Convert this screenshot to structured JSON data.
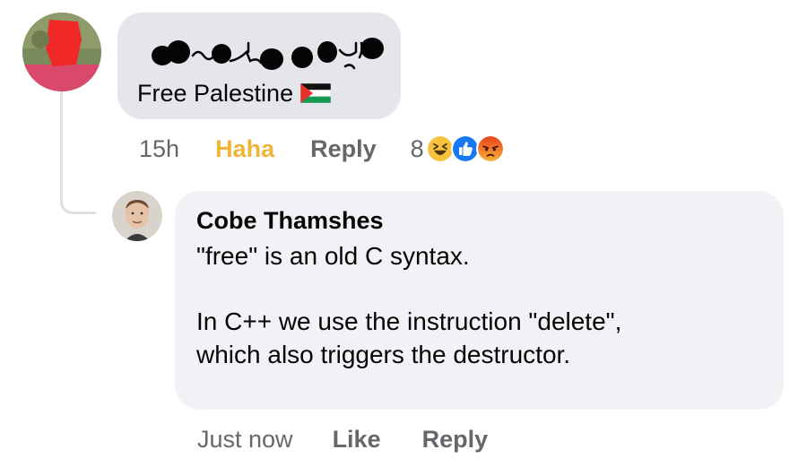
{
  "comment_1": {
    "text": "Free Palestine",
    "emoji": "palestine-flag",
    "time": "15h",
    "active_reaction_label": "Haha",
    "reply_label": "Reply",
    "reaction_count": "8",
    "reaction_icons": [
      "haha-icon",
      "like-icon",
      "angry-icon"
    ]
  },
  "comment_2": {
    "author": "Cobe Thamshes",
    "text_line_1": "\"free\" is an old C syntax.",
    "text_line_2": "In C++ we use the instruction \"delete\",",
    "text_line_3": "which also triggers the destructor.",
    "time": "Just now",
    "like_label": "Like",
    "reply_label": "Reply"
  },
  "colors": {
    "bubble_1": "#e4e6eb",
    "bubble_2": "#f0f2f5",
    "meta_text": "#65676b",
    "haha_active": "#f0b43a"
  }
}
